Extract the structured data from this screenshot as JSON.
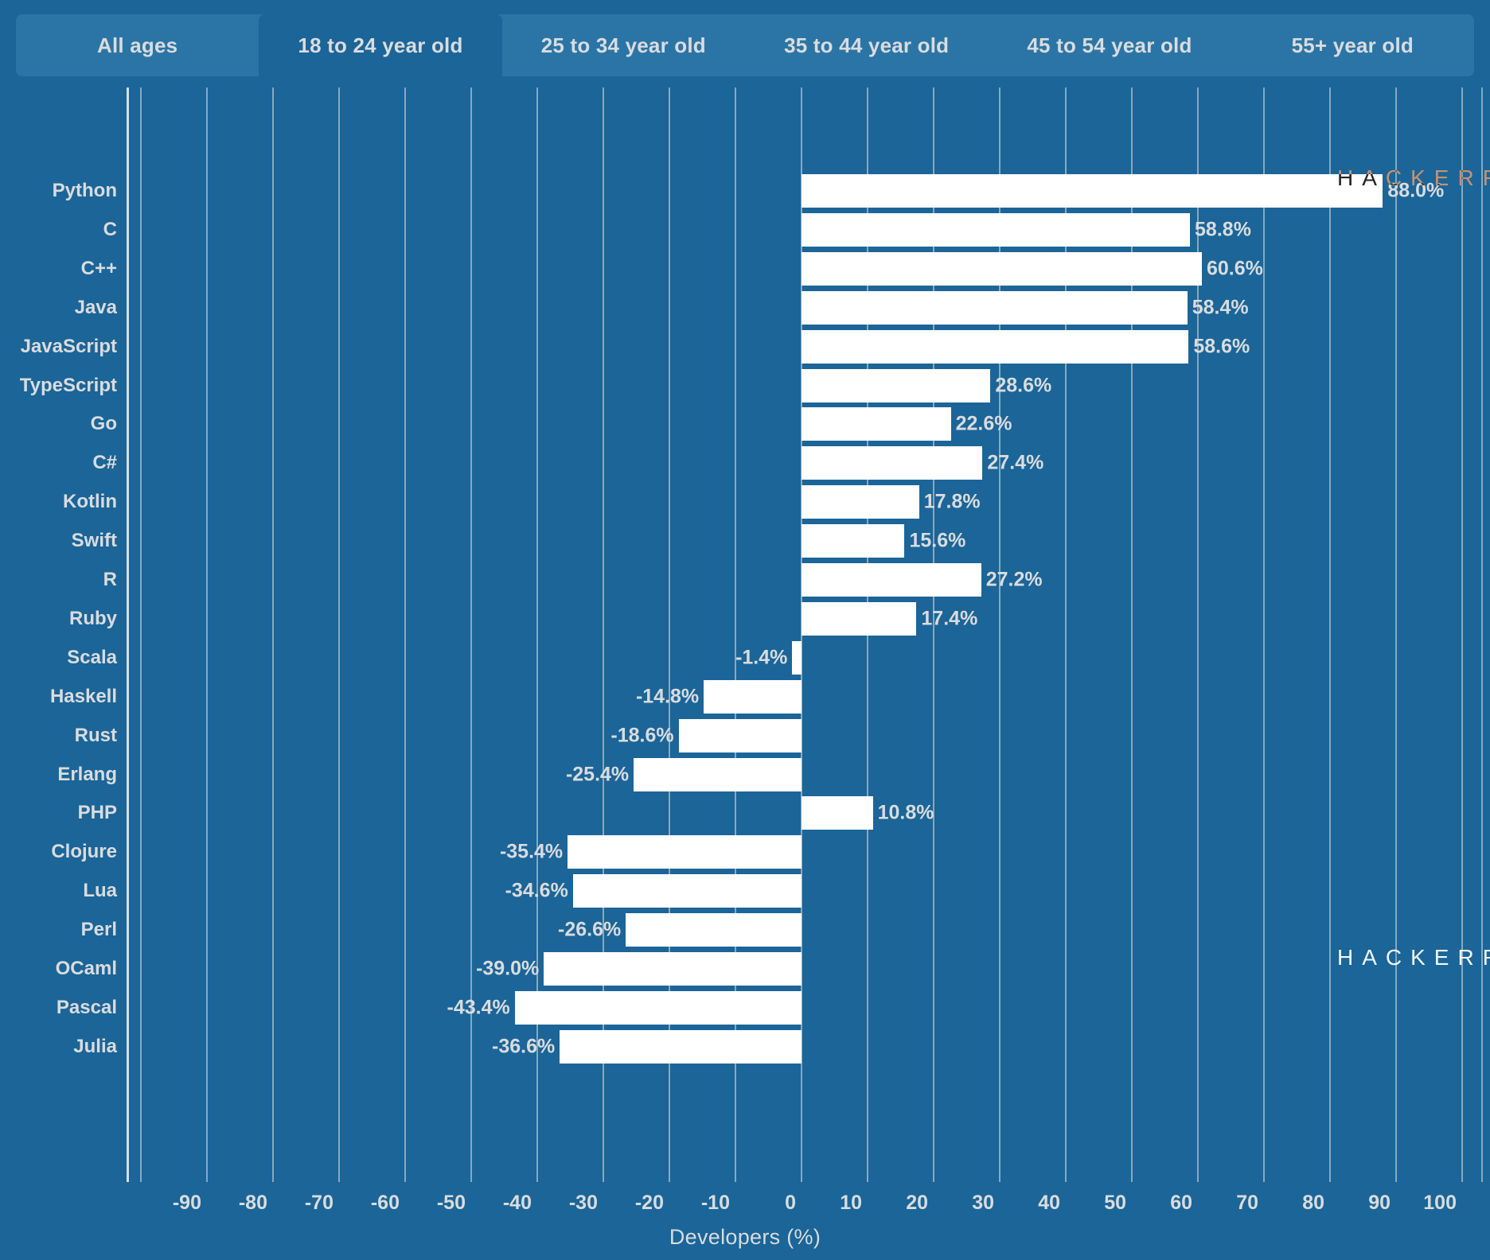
{
  "tabs": [
    {
      "label": "All ages",
      "active": false
    },
    {
      "label": "18 to 24 year old",
      "active": true
    },
    {
      "label": "25 to 34 year old",
      "active": false
    },
    {
      "label": "35 to 44 year old",
      "active": false
    },
    {
      "label": "45 to 54 year old",
      "active": false
    },
    {
      "label": "55+ year old",
      "active": false
    }
  ],
  "watermark": {
    "top": "HACKERRANK",
    "middle": "HACKERRANK"
  },
  "colors": {
    "background": "#1b6598",
    "tabbar": "#2b75a6",
    "tab_active": "#1b6598",
    "bar": "#ffffff",
    "text": "#dadcde",
    "gridline": "#c8d3db"
  },
  "chart_data": {
    "type": "bar",
    "orientation": "horizontal",
    "title": "",
    "xlabel": "Developers (%)",
    "ylabel": "",
    "xlim": [
      -100,
      105
    ],
    "xticks": [
      -90,
      -80,
      -70,
      -60,
      -50,
      -40,
      -30,
      -20,
      -10,
      0,
      10,
      20,
      30,
      40,
      50,
      60,
      70,
      80,
      90,
      100
    ],
    "xticklabels": [
      "-90",
      "-80",
      "-70",
      "-60",
      "-50",
      "-40",
      "-30",
      "-20",
      "-10",
      "0",
      "10",
      "20",
      "30",
      "40",
      "50",
      "60",
      "70",
      "80",
      "90",
      "100"
    ],
    "grid": true,
    "legend": null,
    "categories": [
      "Python",
      "C",
      "C++",
      "Java",
      "JavaScript",
      "TypeScript",
      "Go",
      "C#",
      "Kotlin",
      "Swift",
      "R",
      "Ruby",
      "Scala",
      "Haskell",
      "Rust",
      "Erlang",
      "PHP",
      "Clojure",
      "Lua",
      "Perl",
      "OCaml",
      "Pascal",
      "Julia"
    ],
    "values": [
      88.0,
      58.8,
      60.6,
      58.4,
      58.6,
      28.6,
      22.6,
      27.4,
      17.8,
      15.6,
      27.2,
      17.4,
      -1.4,
      -14.8,
      -18.6,
      -25.4,
      10.8,
      -35.4,
      -34.6,
      -26.6,
      -39.0,
      -43.4,
      -36.6
    ],
    "value_labels": [
      "88.0%",
      "58.8%",
      "60.6%",
      "58.4%",
      "58.6%",
      "28.6%",
      "22.6%",
      "27.4%",
      "17.8%",
      "15.6%",
      "27.2%",
      "17.4%",
      "-1.4%",
      "-14.8%",
      "-18.6%",
      "-25.4%",
      "10.8%",
      "-35.4%",
      "-34.6%",
      "-26.6%",
      "-39.0%",
      "-43.4%",
      "-36.6%"
    ]
  }
}
